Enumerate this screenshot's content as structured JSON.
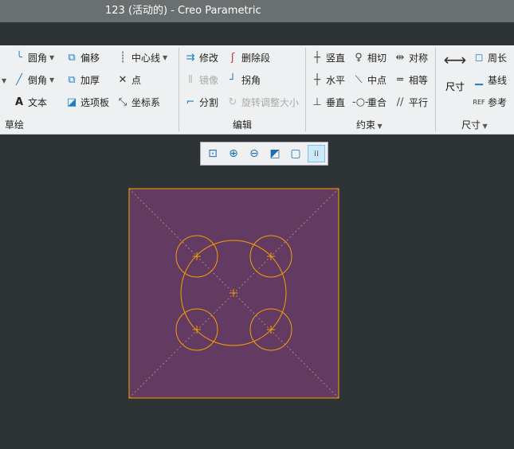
{
  "window": {
    "title": "123 (活动的) - Creo Parametric"
  },
  "ribbon": {
    "sketch": {
      "group": "草绘",
      "fillet": "圆角",
      "chamfer": "倒角",
      "text": "文本",
      "offset": "偏移",
      "thicken": "加厚",
      "palette": "选项板",
      "centerline": "中心线",
      "point": "点",
      "coordsys": "坐标系"
    },
    "edit": {
      "group": "编辑",
      "modify": "修改",
      "delete_segment": "删除段",
      "mirror": "镜像",
      "corner": "拐角",
      "divide": "分割",
      "rotate_resize": "旋转调整大小"
    },
    "constrain": {
      "group": "约束",
      "vertical": "竖直",
      "horizontal": "水平",
      "perpendicular": "垂直",
      "tangent": "相切",
      "midpoint": "中点",
      "coincident": "重合",
      "symmetric": "对称",
      "equal": "相等",
      "parallel": "平行"
    },
    "dimension": {
      "group": "尺寸",
      "dimension": "尺寸",
      "perimeter": "周长",
      "baseline": "基线",
      "reference": "参考"
    }
  },
  "viewbar": [
    "zoom-fit",
    "zoom-in",
    "zoom-out",
    "display-style",
    "saved-views",
    "sketch-display"
  ],
  "colors": {
    "sketch_fill": "#633a62",
    "sketch_line": "#f5a000",
    "canvas": "#2e3435"
  }
}
